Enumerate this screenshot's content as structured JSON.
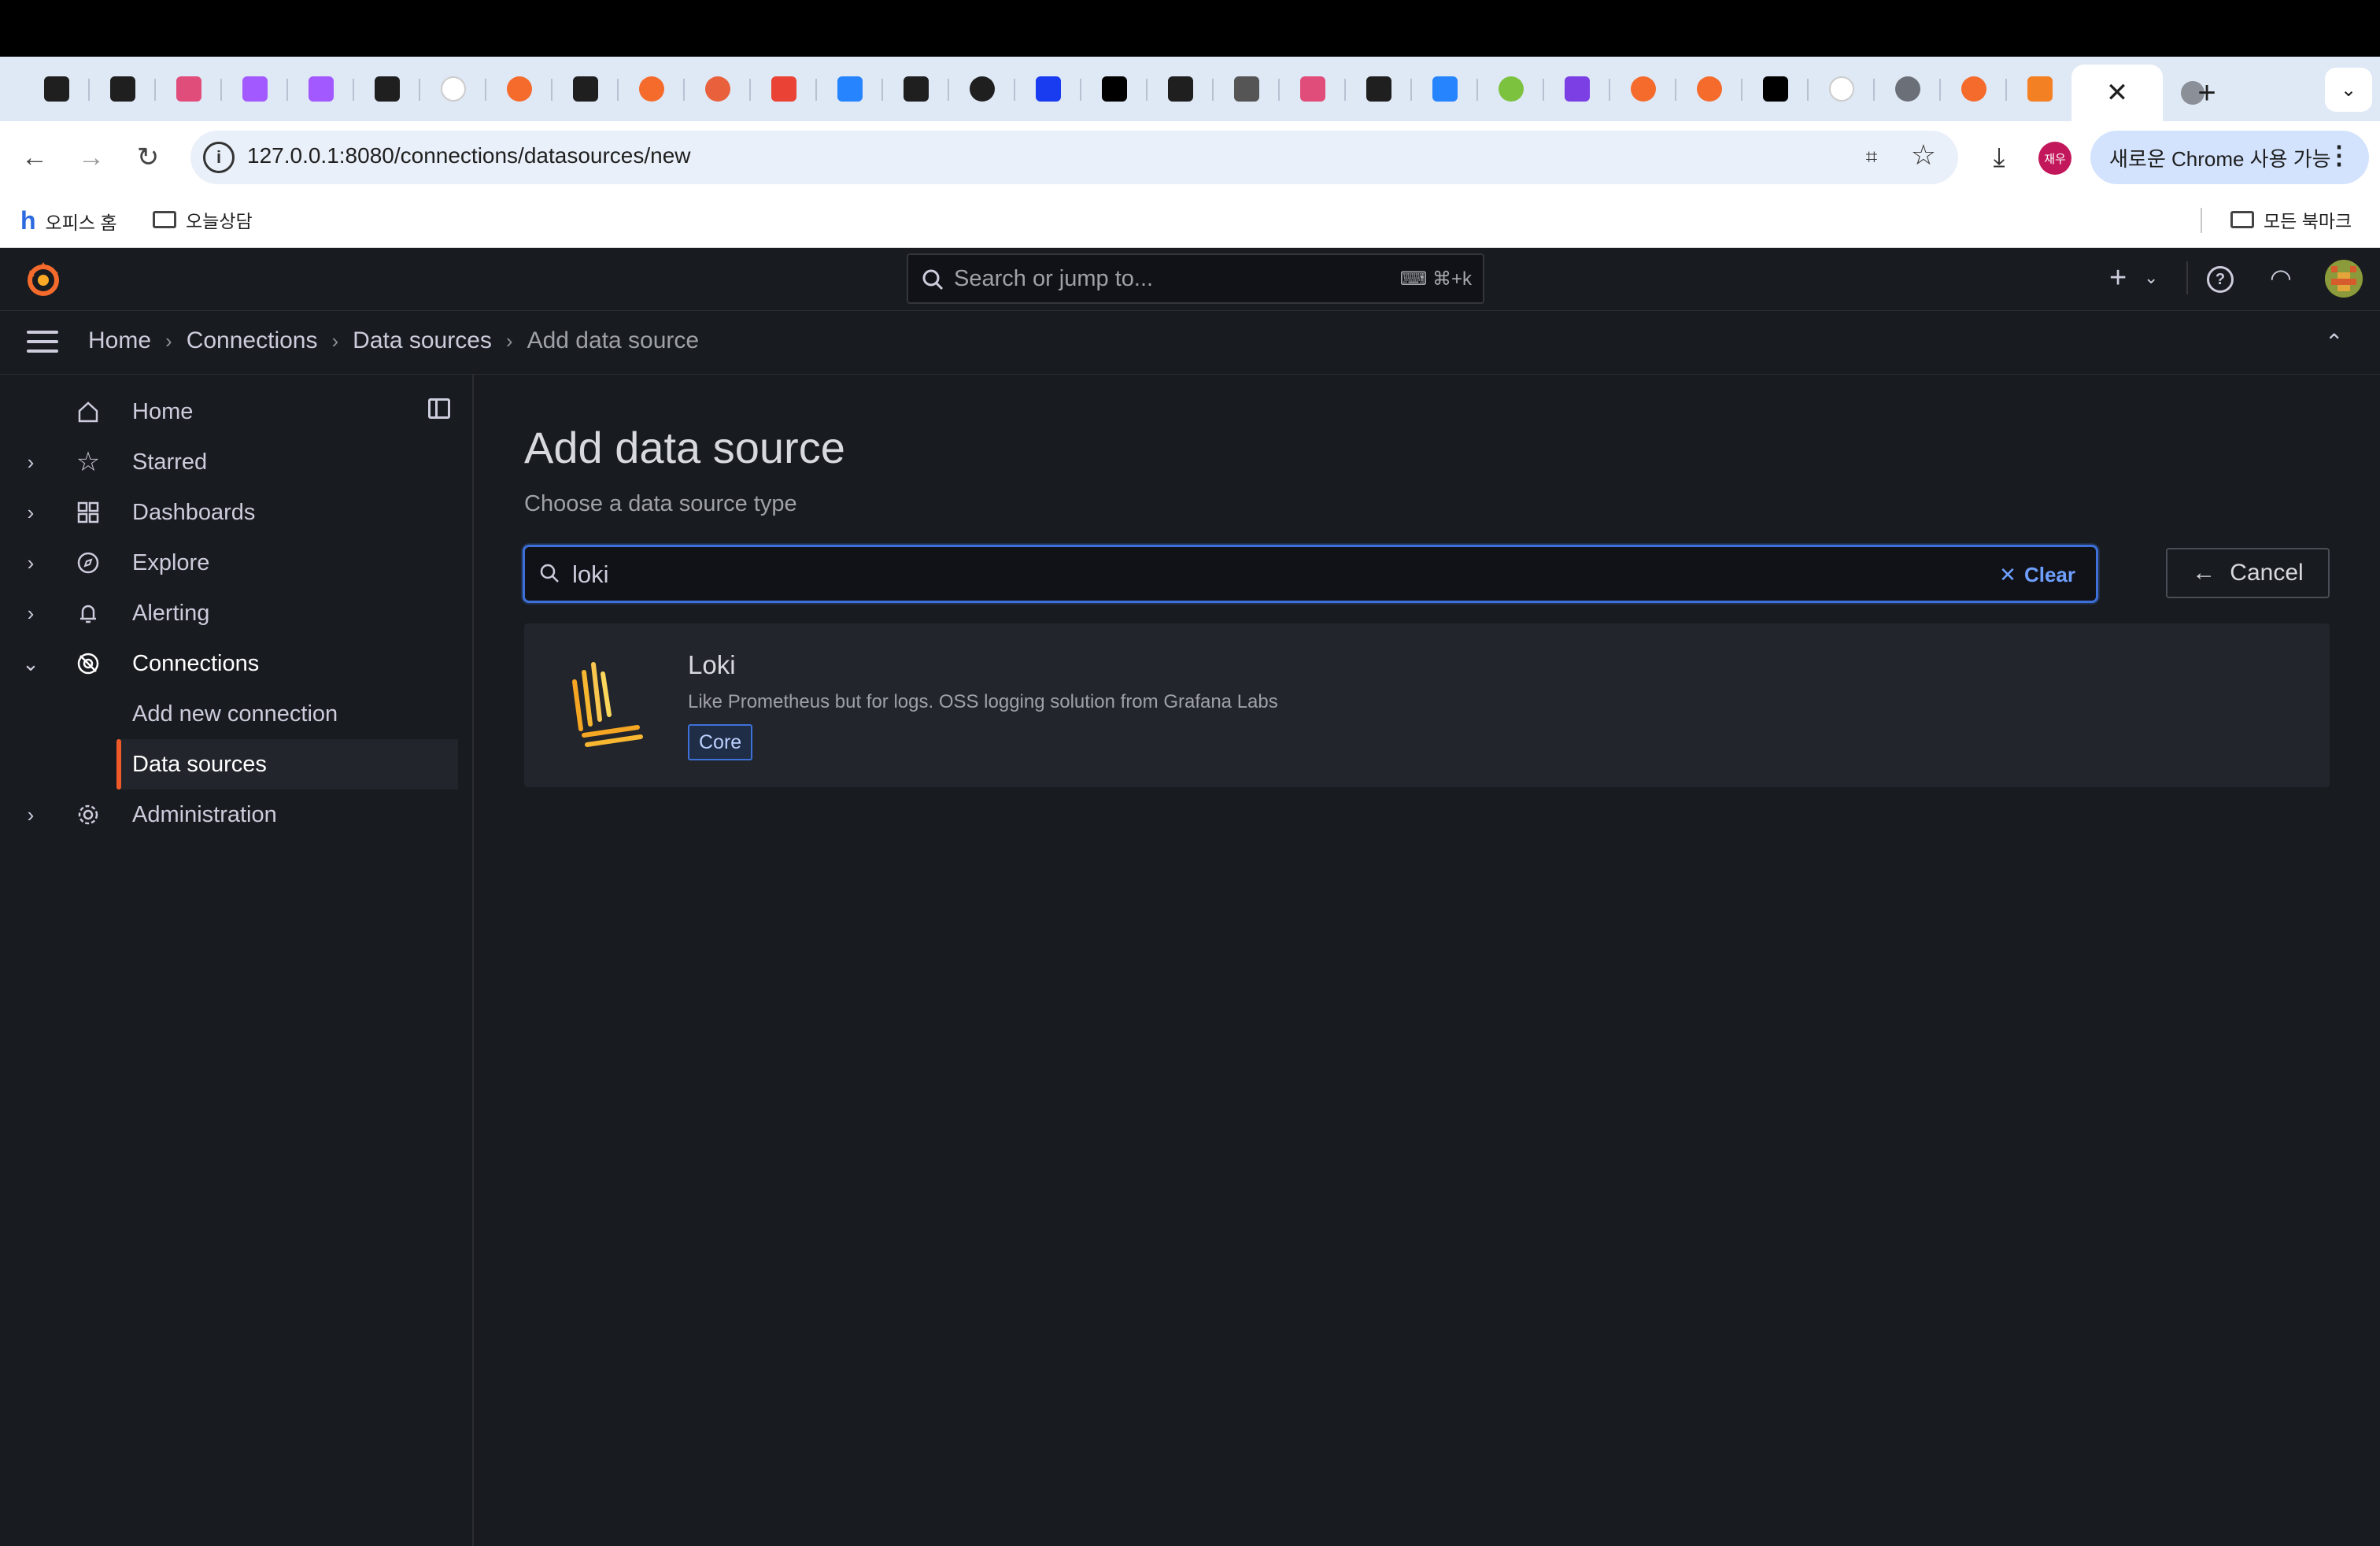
{
  "browser": {
    "url": "127.0.0.1:8080/connections/datasources/new",
    "update_button": "새로운 Chrome 사용 가능",
    "profile_label": "재우",
    "bookmarks": [
      "오피스 홈",
      "오늘상담"
    ],
    "bookmarks_right": "모든 북마크",
    "tab_icons": [
      "notion-icon",
      "github-icon",
      "stackedit-icon",
      "figma-icon",
      "figma-icon",
      "github-icon",
      "google-icon",
      "grafana-icon",
      "github-icon",
      "grafana-icon",
      "swagger-icon",
      "gmail-icon",
      "confluence-icon",
      "github-icon",
      "circle-icon",
      "bookmark-icon",
      "medium-icon",
      "notion-icon",
      "bug-icon",
      "stackedit-icon",
      "github-icon",
      "jira-icon",
      "green-app-icon",
      "purple-app-icon",
      "grafana-icon",
      "grafana-icon",
      "medium-icon",
      "google-icon",
      "globe-icon",
      "grafana-icon",
      "stackoverflow-icon"
    ],
    "colors": {
      "tabstrip": "#dfe8f5",
      "accent": "#d3e3fd"
    }
  },
  "grafana": {
    "search_placeholder": "Search or jump to...",
    "search_shortcut": "⌘+k",
    "breadcrumbs": [
      "Home",
      "Connections",
      "Data sources",
      "Add data source"
    ],
    "nav": {
      "home": "Home",
      "starred": "Starred",
      "dashboards": "Dashboards",
      "explore": "Explore",
      "alerting": "Alerting",
      "connections": "Connections",
      "add_new_connection": "Add new connection",
      "data_sources": "Data sources",
      "administration": "Administration"
    },
    "page": {
      "title": "Add data source",
      "subtitle": "Choose a data source type",
      "search_value": "loki",
      "clear_label": "Clear",
      "cancel_label": "Cancel"
    },
    "results": [
      {
        "name": "Loki",
        "description": "Like Prometheus but for logs. OSS logging solution from Grafana Labs",
        "badge": "Core"
      }
    ],
    "colors": {
      "accent": "#f05a28",
      "focus": "#3d71d9",
      "link": "#6e9fff"
    }
  }
}
